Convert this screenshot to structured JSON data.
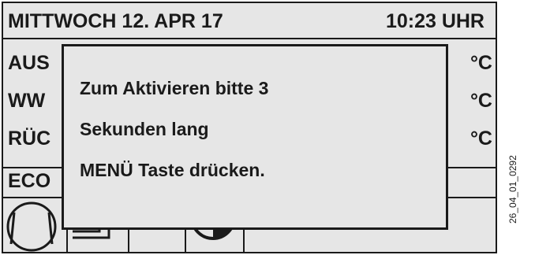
{
  "header": {
    "date": "MITTWOCH  12. APR 17",
    "time": "10:23 UHR"
  },
  "readings": [
    {
      "label": "AUS",
      "unit": "°C"
    },
    {
      "label": "WW",
      "unit": "°C"
    },
    {
      "label": "RÜC",
      "unit": "°C"
    }
  ],
  "status": {
    "label": "ECO"
  },
  "dialog": {
    "line1": "Zum Aktivieren bitte 3",
    "line2": "Sekunden lang",
    "line3": "MENÜ Taste drücken."
  },
  "figure_code": "26_04_01_0292",
  "icons": [
    "compressor-icon",
    "pipe-icon",
    "half-circle-icon"
  ],
  "colors": {
    "screen_bg": "#e6e6e6",
    "ink": "#1a1a1a"
  }
}
